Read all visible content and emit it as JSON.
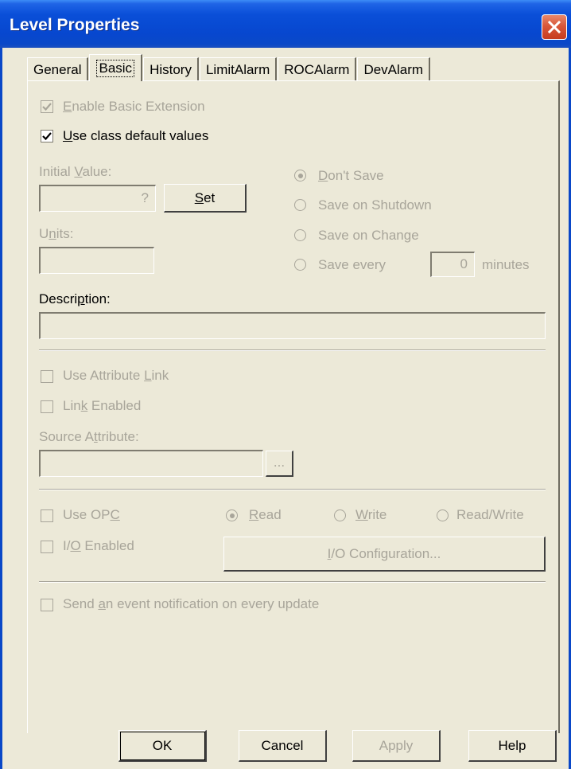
{
  "window": {
    "title": "Level Properties"
  },
  "tabs": [
    "General",
    "Basic",
    "History",
    "LimitAlarm",
    "ROCAlarm",
    "DevAlarm"
  ],
  "basic": {
    "enable_basic_extension": {
      "pre": "",
      "accel": "E",
      "post": "nable Basic Extension",
      "checked": true
    },
    "use_class_defaults": {
      "pre": "",
      "accel": "U",
      "post": "se class default values",
      "checked": true
    },
    "initial_value": {
      "pre": "Initial ",
      "accel": "V",
      "post": "alue:",
      "value": "?"
    },
    "set_button": {
      "pre": "",
      "accel": "S",
      "post": "et"
    },
    "units": {
      "pre": "U",
      "accel": "n",
      "post": "its:",
      "value": ""
    },
    "save_options": [
      {
        "pre": "",
        "accel": "D",
        "post": "on't Save",
        "selected": true
      },
      {
        "pre": "Save on Shutdown",
        "accel": "",
        "post": "",
        "selected": false
      },
      {
        "pre": "Save on Change",
        "accel": "",
        "post": "",
        "selected": false
      },
      {
        "pre": "Save every",
        "accel": "",
        "post": "",
        "selected": false
      }
    ],
    "save_every_value": "0",
    "minutes_label": "minutes",
    "description": {
      "pre": "Descri",
      "accel": "p",
      "post": "tion:",
      "value": ""
    }
  },
  "link": {
    "use_attribute_link": {
      "pre": "Use Attribute ",
      "accel": "L",
      "post": "ink",
      "checked": false
    },
    "link_enabled": {
      "pre": "Lin",
      "accel": "k",
      "post": " Enabled",
      "checked": false
    },
    "source_attribute": {
      "pre": "Source A",
      "accel": "t",
      "post": "tribute:",
      "value": ""
    },
    "browse_label": "..."
  },
  "opc": {
    "use_opc": {
      "pre": "Use OP",
      "accel": "C",
      "post": "",
      "checked": false
    },
    "io_enabled": {
      "pre": "I/",
      "accel": "O",
      "post": " Enabled",
      "checked": false
    },
    "modes": [
      {
        "pre": "",
        "accel": "R",
        "post": "ead",
        "selected": true
      },
      {
        "pre": "",
        "accel": "W",
        "post": "rite",
        "selected": false
      },
      {
        "pre": "Read/Write",
        "accel": "",
        "post": "",
        "selected": false
      }
    ],
    "io_config_button": {
      "pre": "",
      "accel": "I",
      "post": "/O Configuration..."
    }
  },
  "event_notification": {
    "pre": "Send ",
    "accel": "a",
    "post": "n event notification on every update",
    "checked": false
  },
  "footer": {
    "ok": "OK",
    "cancel": "Cancel",
    "apply": "Apply",
    "help": "Help"
  },
  "colors": {
    "title_bar": "#0a4fd8",
    "dialog_bg": "#ece9d8",
    "disabled_text": "#a8a59a",
    "close_button": "#d9573a"
  }
}
